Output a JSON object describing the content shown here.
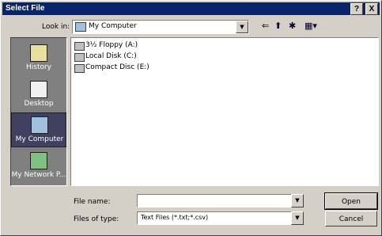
{
  "dialog": {
    "title": "Select File",
    "help_label": "?",
    "close_label": "X"
  },
  "lookin": {
    "label": "Look in:",
    "value": "My Computer",
    "dropdown_glyph": "▼"
  },
  "toolbar": {
    "back_glyph": "⇐",
    "up_glyph": "⬆",
    "newfolder_glyph": "✱",
    "view_glyph": "▦▾"
  },
  "places": [
    {
      "label": "History",
      "icon": "history-icon",
      "color": "#e8e0a0"
    },
    {
      "label": "Desktop",
      "icon": "desktop-icon",
      "color": "#f0f0f0"
    },
    {
      "label": "My Computer",
      "icon": "my-computer-icon",
      "color": "#a0c0e0"
    },
    {
      "label": "My Network P...",
      "icon": "network-places-icon",
      "color": "#80c080"
    }
  ],
  "files": [
    {
      "name": "3½ Floppy (A:)",
      "icon": "floppy-icon"
    },
    {
      "name": "Local Disk (C:)",
      "icon": "hard-disk-icon"
    },
    {
      "name": "Compact Disc (E:)",
      "icon": "cd-drive-icon"
    }
  ],
  "filename": {
    "label": "File name:",
    "value": ""
  },
  "filetype": {
    "label": "Files of type:",
    "value": "Text Files (*.txt;*.csv)"
  },
  "buttons": {
    "open": "Open",
    "cancel": "Cancel"
  }
}
